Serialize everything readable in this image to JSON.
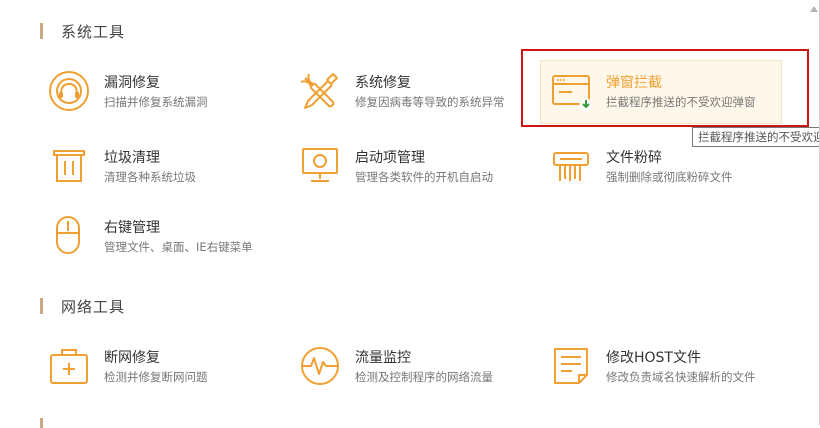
{
  "sections": {
    "system_title": "系统工具",
    "network_title": "网络工具"
  },
  "system_tools": [
    {
      "name": "漏洞修复",
      "desc": "扫描并修复系统漏洞",
      "icon": "shield-headset-icon"
    },
    {
      "name": "系统修复",
      "desc": "修复因病毒等导致的系统异常",
      "icon": "wrench-screwdriver-icon"
    },
    {
      "name": "弹窗拦截",
      "desc": "拦截程序推送的不受欢迎弹窗",
      "icon": "popup-window-icon"
    },
    {
      "name": "垃圾清理",
      "desc": "清理各种系统垃圾",
      "icon": "trash-can-icon"
    },
    {
      "name": "启动项管理",
      "desc": "管理各类软件的开机自启动",
      "icon": "monitor-icon"
    },
    {
      "name": "文件粉碎",
      "desc": "强制删除或彻底粉碎文件",
      "icon": "shredder-icon"
    },
    {
      "name": "右键管理",
      "desc": "管理文件、桌面、IE右键菜单",
      "icon": "mouse-icon"
    }
  ],
  "network_tools": [
    {
      "name": "断网修复",
      "desc": "检测并修复断网问题",
      "icon": "first-aid-kit-icon"
    },
    {
      "name": "流量监控",
      "desc": "检测及控制程序的网络流量",
      "icon": "pulse-monitor-icon"
    },
    {
      "name": "修改HOST文件",
      "desc": "修改负责域名快速解析的文件",
      "icon": "document-icon"
    }
  ],
  "tooltip": "拦截程序推送的不受欢迎",
  "colors": {
    "accent": "#f0a032",
    "highlight_bg": "#fff8ea",
    "frame": "#cc1414",
    "section_bar": "#c8a983"
  }
}
